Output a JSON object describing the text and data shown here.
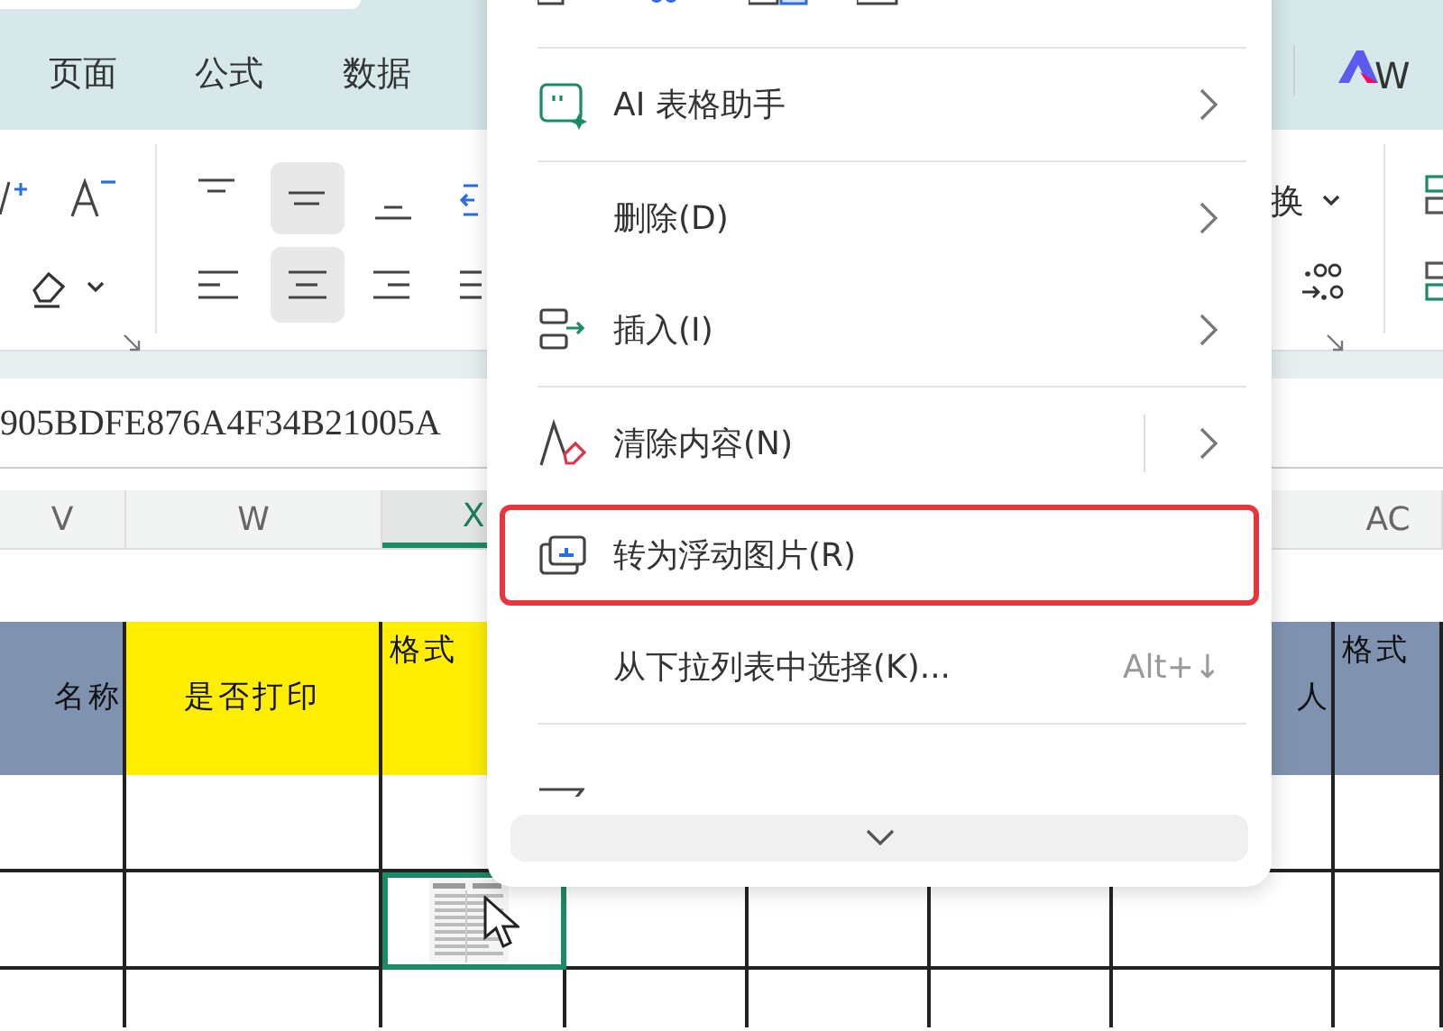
{
  "ribbon_tabs": [
    {
      "label": "页面"
    },
    {
      "label": "公式"
    },
    {
      "label": "数据"
    }
  ],
  "brand_button": {
    "label": "W"
  },
  "toolbar": {
    "convert_label": "换"
  },
  "formula_bar": {
    "value": "905BDFE876A4F34B21005A"
  },
  "columns": [
    {
      "label": "V",
      "selected": false
    },
    {
      "label": "W",
      "selected": false
    },
    {
      "label": "X",
      "selected": true
    },
    {
      "label": "AC",
      "selected": false
    }
  ],
  "header_row": [
    {
      "text": "名称",
      "color": "#7f93b0"
    },
    {
      "text": "是否打印",
      "color": "#ffee00"
    },
    {
      "text": "格式",
      "color": "#ffee00"
    },
    {
      "text": "人",
      "color": "#7f93b0"
    },
    {
      "text": "格式",
      "color": "#7f93b0"
    }
  ],
  "data_rows": [
    {
      "cells": [
        {
          "kind": "empty",
          "selected": false
        },
        {
          "kind": "empty",
          "selected": false
        },
        {
          "kind": "empty",
          "selected": false
        },
        {
          "kind": "empty",
          "selected": false
        },
        {
          "kind": "empty",
          "selected": false
        }
      ]
    },
    {
      "cells": [
        {
          "kind": "empty",
          "selected": false
        },
        {
          "kind": "empty",
          "selected": false
        },
        {
          "kind": "picture",
          "selected": true
        },
        {
          "kind": "empty",
          "selected": false
        },
        {
          "kind": "empty",
          "selected": false
        }
      ]
    },
    {
      "cells": [
        {
          "kind": "empty",
          "selected": false
        },
        {
          "kind": "empty",
          "selected": false
        },
        {
          "kind": "empty",
          "selected": false
        },
        {
          "kind": "empty",
          "selected": false
        },
        {
          "kind": "empty",
          "selected": false
        }
      ]
    }
  ],
  "context_menu": {
    "items": [
      {
        "label": "AI 表格助手",
        "has_submenu": true,
        "highlighted": false
      },
      {
        "label": "删除(D)",
        "has_submenu": true,
        "highlighted": false
      },
      {
        "label": "插入(I)",
        "has_submenu": true,
        "highlighted": false
      },
      {
        "label": "清除内容(N)",
        "has_submenu": true,
        "split": true,
        "highlighted": false
      },
      {
        "label": "转为浮动图片(R)",
        "highlighted": true
      },
      {
        "label": "从下拉列表中选择(K)...",
        "shortcut": "Alt+↓",
        "highlighted": false
      }
    ]
  }
}
